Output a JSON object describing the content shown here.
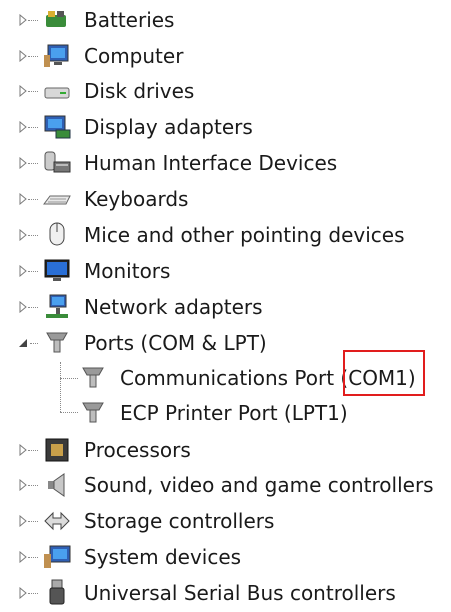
{
  "tree": {
    "batteries": "Batteries",
    "computer": "Computer",
    "disk_drives": "Disk drives",
    "display_adapters": "Display adapters",
    "hid": "Human Interface Devices",
    "keyboards": "Keyboards",
    "mice": "Mice and other pointing devices",
    "monitors": "Monitors",
    "network_adapters": "Network adapters",
    "ports": {
      "label": "Ports (COM & LPT)",
      "children": [
        {
          "label": "Communications Port (COM1)",
          "highlight": "(COM1)"
        },
        {
          "label": "ECP Printer Port (LPT1)"
        }
      ]
    },
    "processors": "Processors",
    "sound": "Sound, video and game controllers",
    "storage": "Storage controllers",
    "system_devices": "System devices",
    "usb": "Universal Serial Bus controllers"
  },
  "colors": {
    "highlight_box": "#e11d1d"
  }
}
